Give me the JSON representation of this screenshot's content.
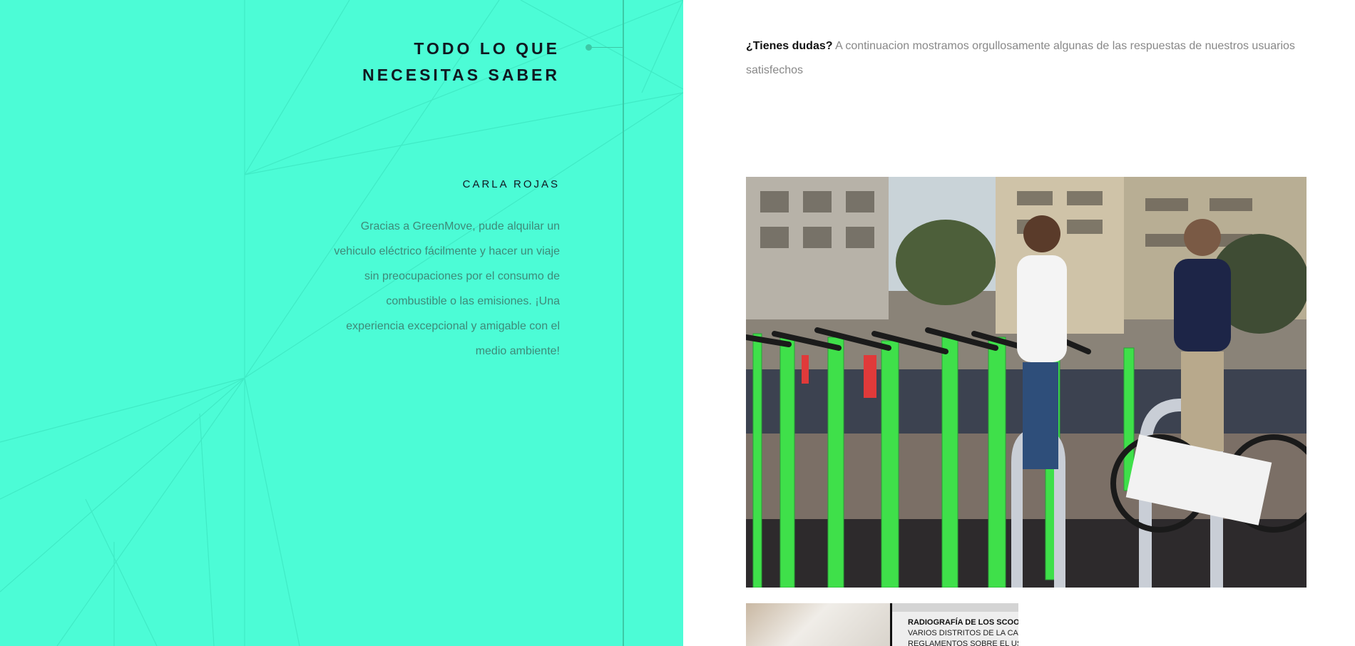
{
  "section": {
    "title_line1": "TODO LO QUE",
    "title_line2": "NECESITAS SABER"
  },
  "testimonial": {
    "author": "CARLA ROJAS",
    "text": "Gracias a GreenMove, pude alquilar un vehiculo eléctrico fácilmente y hacer un viaje sin preocupaciones por el consumo de combustible o las emisiones. ¡Una experiencia excepcional y amigable con el medio ambiente!"
  },
  "intro": {
    "question": "¿Tienes dudas?",
    "text": " A continuacion mostramos orgullosamente algunas de las respuestas de nuestros usuarios satisfechos"
  },
  "secondary_image": {
    "headline": "RADIOGRAFÍA DE LOS SCOO",
    "line1": "VARIOS DISTRITOS DE LA CA",
    "line2": "REGLAMENTOS SOBRE EL US"
  },
  "colors": {
    "accent_teal": "#4cfcd6",
    "line_teal": "#3cc9a6",
    "scooter_green": "#3fe04a",
    "text_dark": "#101820",
    "text_muted": "#888888"
  }
}
